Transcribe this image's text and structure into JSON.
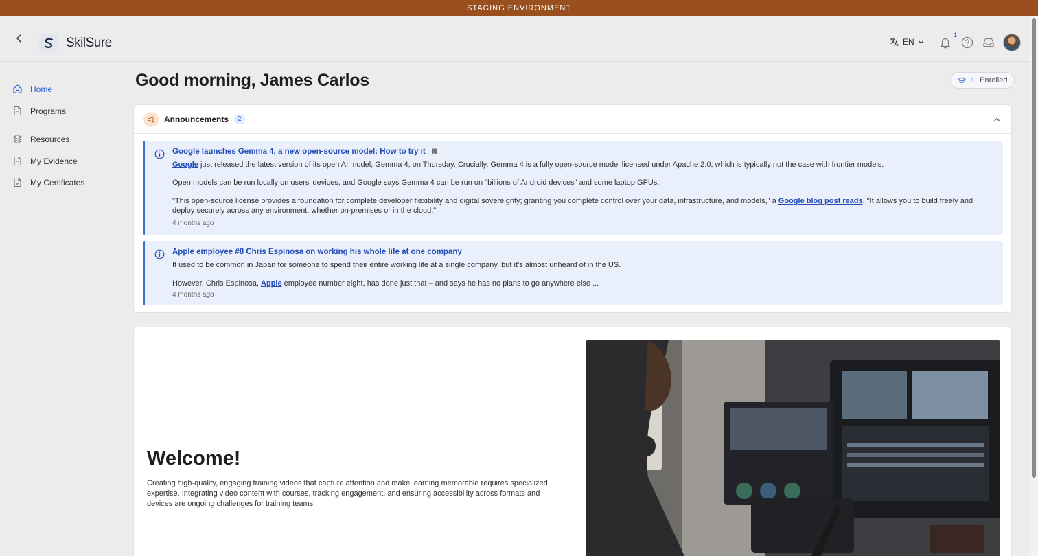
{
  "env_banner": "STAGING ENVIRONMENT",
  "brand": {
    "name": "SkilSure"
  },
  "header": {
    "lang": "EN",
    "notification_count": "1"
  },
  "sidebar": {
    "items": [
      {
        "label": "Home",
        "icon": "home-icon",
        "active": true
      },
      {
        "label": "Programs",
        "icon": "document-icon"
      },
      {
        "label": "Resources",
        "icon": "layers-icon"
      },
      {
        "label": "My Evidence",
        "icon": "document-icon"
      },
      {
        "label": "My Certificates",
        "icon": "certificate-icon"
      }
    ]
  },
  "greeting": "Good morning, James Carlos",
  "enrolled": {
    "count": "1",
    "label": "Enrolled"
  },
  "announcements": {
    "title": "Announcements",
    "count": "2",
    "items": [
      {
        "title": "Google launches Gemma 4, a new open-source model: How to try it",
        "p1_link": "Google",
        "p1_rest": " just released the latest version of its open AI model, Gemma 4, on Thursday. Crucially, Gemma 4 is a fully open-source model licensed under Apache 2.0, which is typically not the case with frontier models.",
        "p2": "Open models can be run locally on users' devices, and Google says Gemma 4 can be run on \"billions of Android devices\" and some laptop GPUs.",
        "p3_pre": "\"This open-source license provides a foundation for complete developer flexibility and digital sovereignty; granting you complete control over your data, infrastructure, and models,\" a ",
        "p3_link": "Google blog post reads",
        "p3_post": ". \"It allows you to build freely and deploy securely across any environment, whether on-premises or in the cloud.\"",
        "time": "4 months ago"
      },
      {
        "title": "Apple employee #8 Chris Espinosa on working his whole life at one company",
        "p1": "It used to be common in Japan for someone to spend their entire working life at a single company, but it’s almost unheard of in the US.",
        "p2_pre": "However, Chris Espinosa, ",
        "p2_link": "Apple",
        "p2_post": " employee number eight, has done just that – and says he has no plans to go anywhere else ...",
        "time": "4 months ago"
      }
    ]
  },
  "welcome": {
    "title": "Welcome!",
    "text": "Creating high-quality, engaging training videos that capture attention and make learning memorable requires specialized expertise. Integrating video content with courses, tracking engagement, and ensuring accessibility across formats and devices are ongoing challenges for training teams."
  },
  "colors": {
    "banner": "#9a4f1e",
    "accent": "#2f63d8",
    "announcement_bg": "#e9f0fb"
  }
}
